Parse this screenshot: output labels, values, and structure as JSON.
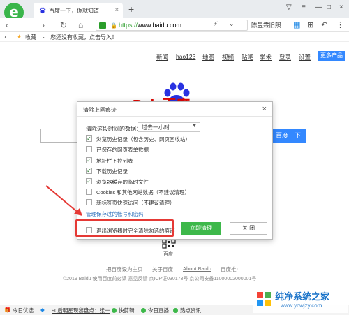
{
  "browser": {
    "tab_title": "百度一下，你就知道",
    "url_prefix": "https://",
    "url_host": "www.baidu.com",
    "search_hint": "陈昱霖旧照",
    "favorites_label": "收藏",
    "favorites_hint": "您还没有收藏，点击导入！"
  },
  "baidu": {
    "nav": [
      "新闻",
      "hao123",
      "地图",
      "视频",
      "贴吧",
      "学术",
      "登录",
      "设置"
    ],
    "more_products": "更多产品",
    "logo_text": "Bai  百度",
    "search_button": "百度一下",
    "qr_label": "百度",
    "footer_links": [
      "把百度设为主页",
      "关于百度",
      "About Baidu",
      "百度推广"
    ],
    "footer_line": "©2019 Baidu 使用百度前必读 意见反馈 京ICP证030173号  京公网安备11000002000001号"
  },
  "dialog": {
    "title": "清除上网痕迹",
    "close_glyph": "×",
    "range_label": "清除这段时间的数据：",
    "range_value": "过去一小时",
    "options": [
      {
        "label": "浏览历史记录（包含历史、网页回收站）",
        "checked": true
      },
      {
        "label": "已保存的网页表单数据",
        "checked": false
      },
      {
        "label": "地址栏下拉列表",
        "checked": true
      },
      {
        "label": "下载历史记录",
        "checked": true
      },
      {
        "label": "浏览器缓存的临时文件",
        "checked": true
      },
      {
        "label": "Cookies 和其他网站数据（不建议清理）",
        "checked": false
      },
      {
        "label": "新标签页快速访问（不建议清理）",
        "checked": false
      }
    ],
    "manage_link": "管理保存过的帐号和密码",
    "exit_option": "退出浏览器时完全清除勾选的痕迹",
    "clear_button": "立即清理",
    "close_button": "关 闭"
  },
  "statusbar": {
    "items": [
      "今日优选",
      "90后明星现黎盘点：张一",
      "快剪辑",
      "今日直播",
      "热点资讯"
    ]
  },
  "watermark": {
    "title": "纯净系统之家",
    "url": "www.ycwjzy.com"
  },
  "colors": {
    "accent_green": "#3db84a",
    "baidu_blue": "#3388ff",
    "annotation_red": "#e53935"
  }
}
